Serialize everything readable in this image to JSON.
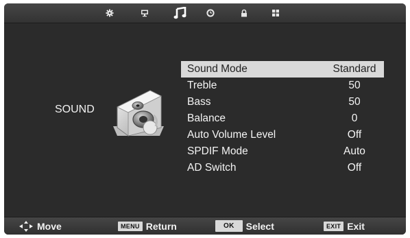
{
  "top_icons": [
    "gear-icon",
    "monitor-icon",
    "music-note-icon",
    "clock-icon",
    "lock-icon",
    "grid-icon"
  ],
  "active_tab": "music-note-icon",
  "section": {
    "label": "SOUND",
    "icon": "speaker-icon"
  },
  "menu": {
    "items": [
      {
        "label": "Sound Mode",
        "value": "Standard",
        "selected": true
      },
      {
        "label": "Treble",
        "value": "50"
      },
      {
        "label": "Bass",
        "value": "50"
      },
      {
        "label": "Balance",
        "value": "0"
      },
      {
        "label": "Auto Volume Level",
        "value": "Off"
      },
      {
        "label": "SPDIF Mode",
        "value": "Auto"
      },
      {
        "label": "AD Switch",
        "value": "Off"
      }
    ]
  },
  "hints": {
    "move": {
      "icon": "dpad-arrows-icon",
      "label": "Move"
    },
    "return": {
      "key": "MENU",
      "label": "Return"
    },
    "select": {
      "key": "OK",
      "label": "Select"
    },
    "exit": {
      "key": "EXIT",
      "label": "Exit"
    }
  },
  "colors": {
    "background": "#2b2b2b",
    "highlight": "#d9d9d9",
    "text": "#f4f4f4"
  }
}
